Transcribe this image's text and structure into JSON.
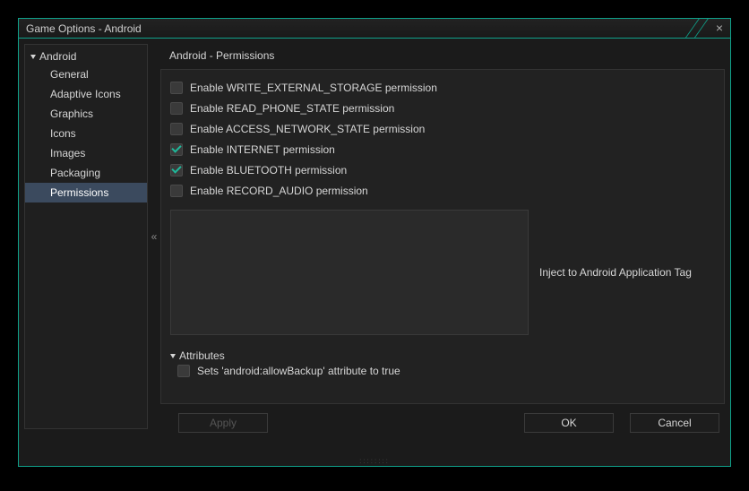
{
  "window": {
    "title": "Game Options - Android"
  },
  "sidebar": {
    "root": "Android",
    "items": [
      {
        "label": "General"
      },
      {
        "label": "Adaptive Icons"
      },
      {
        "label": "Graphics"
      },
      {
        "label": "Icons"
      },
      {
        "label": "Images"
      },
      {
        "label": "Packaging"
      },
      {
        "label": "Permissions",
        "selected": true
      }
    ]
  },
  "collapse_glyph": "«",
  "main": {
    "title": "Android - Permissions",
    "checks": [
      {
        "label": "Enable WRITE_EXTERNAL_STORAGE permission",
        "checked": false
      },
      {
        "label": "Enable READ_PHONE_STATE permission",
        "checked": false
      },
      {
        "label": "Enable ACCESS_NETWORK_STATE permission",
        "checked": false
      },
      {
        "label": "Enable INTERNET permission",
        "checked": true
      },
      {
        "label": "Enable BLUETOOTH permission",
        "checked": true
      },
      {
        "label": "Enable RECORD_AUDIO permission",
        "checked": false
      }
    ],
    "inject_label": "Inject to Android Application Tag",
    "inject_value": "",
    "attributes": {
      "header": "Attributes",
      "items": [
        {
          "label": "Sets 'android:allowBackup' attribute to true",
          "checked": false
        }
      ]
    }
  },
  "footer": {
    "apply": "Apply",
    "ok": "OK",
    "cancel": "Cancel"
  }
}
